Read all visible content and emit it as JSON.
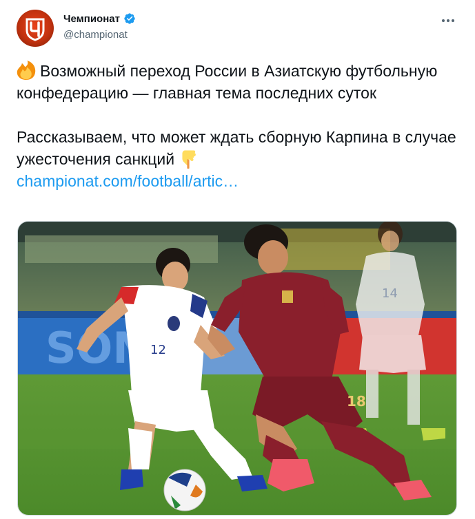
{
  "account": {
    "display_name": "Чемпионат",
    "handle": "@championat",
    "verified": true,
    "avatar_icon": "championat-logo-icon"
  },
  "menu": {
    "icon": "more-options-icon"
  },
  "tweet": {
    "line1": "Возможный переход России в Азиатскую футбольную конфедерацию — главная тема последних суток",
    "line2": "Рассказываем, что может ждать сборную Карпина в случае ужесточения санкций",
    "link_text": "championat.com/football/artic…",
    "emoji1": "fire-emoji-icon",
    "emoji2": "pointing-down-emoji-icon"
  },
  "media": {
    "description_icon": "football-match-photo",
    "jersey_numbers": {
      "russia_player": "18",
      "korea_player": "12",
      "korea_background_player": "14"
    }
  },
  "colors": {
    "link": "#1d9bf0",
    "secondary_text": "#536471",
    "verified": "#1d9bf0",
    "brand": "#e8421b"
  }
}
